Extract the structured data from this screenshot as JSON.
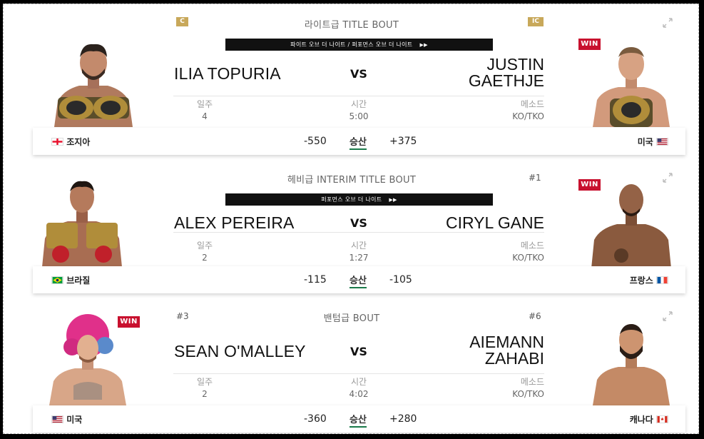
{
  "bouts": [
    {
      "label": "라이트급 TITLE BOUT",
      "rank_left": "C",
      "rank_right": "IC",
      "banner": "파이트 오브 더 나이트 / 퍼포먼스 오브 더 나이트",
      "left": {
        "name": "ILIA TOPURIA",
        "country": "조지아"
      },
      "right": {
        "name1": "JUSTIN",
        "name2": "GAETHJE",
        "country": "미국",
        "result": "WIN"
      },
      "vs": "VS",
      "stats": {
        "round_label": "일주",
        "round": "4",
        "time_label": "시간",
        "time": "5:00",
        "method_label": "메소드",
        "method": "KO/TKO"
      },
      "odds": {
        "left": "-550",
        "mid": "승산",
        "right": "+375"
      }
    },
    {
      "label": "헤비급 INTERIM TITLE BOUT",
      "rank_right": "#1",
      "banner": "퍼포먼스 오브 더 나이트",
      "left": {
        "name": "ALEX PEREIRA",
        "country": "브라질"
      },
      "right": {
        "name": "CIRYL GANE",
        "country": "프랑스",
        "result": "WIN"
      },
      "vs": "VS",
      "stats": {
        "round_label": "일주",
        "round": "2",
        "time_label": "시간",
        "time": "1:27",
        "method_label": "메소드",
        "method": "KO/TKO"
      },
      "odds": {
        "left": "-115",
        "mid": "승산",
        "right": "-105"
      }
    },
    {
      "label": "밴텀급 BOUT",
      "rank_left": "#3",
      "rank_right": "#6",
      "left": {
        "name": "SEAN O'MALLEY",
        "country": "미국",
        "result": "WIN"
      },
      "right": {
        "name1": "AIEMANN",
        "name2": "ZAHABI",
        "country": "캐나다"
      },
      "vs": "VS",
      "stats": {
        "round_label": "일주",
        "round": "2",
        "time_label": "시간",
        "time": "4:02",
        "method_label": "메소드",
        "method": "KO/TKO"
      },
      "odds": {
        "left": "-360",
        "mid": "승산",
        "right": "+280"
      }
    }
  ],
  "colors": {
    "win": "#c8102e",
    "badge_gold": "#c8a85a",
    "odds_underline": "#1a7a4a"
  },
  "icons": [
    "expand-icon",
    "georgia-flag",
    "usa-flag",
    "brazil-flag",
    "france-flag",
    "canada-flag",
    "play-arrows-icon"
  ]
}
